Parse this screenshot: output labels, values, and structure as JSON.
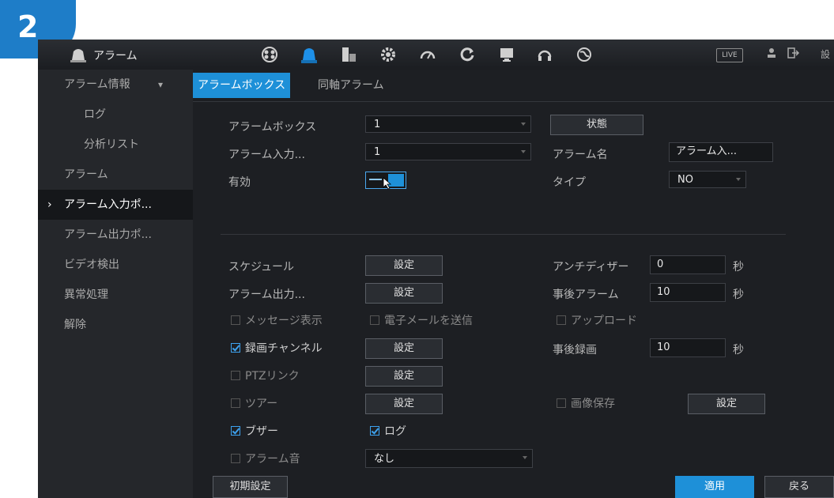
{
  "step_badge": "2",
  "app": {
    "title": "アラーム",
    "live_label": "LIVE",
    "right_text": "設"
  },
  "toolbar_icons": [
    "camera-icon",
    "alarm-icon",
    "storage-icon",
    "settings-icon",
    "gauge-icon",
    "refresh-icon",
    "display-icon",
    "headset-icon",
    "network-icon"
  ],
  "sidebar": {
    "items": [
      {
        "label": "アラーム情報",
        "arrow": "▾"
      },
      {
        "label": "ログ"
      },
      {
        "label": "分析リスト"
      },
      {
        "label": "アラーム"
      },
      {
        "label": "アラーム入力ポ...",
        "prefix": "›"
      },
      {
        "label": "アラーム出力ポ..."
      },
      {
        "label": "ビデオ検出"
      },
      {
        "label": "異常処理"
      },
      {
        "label": "解除"
      }
    ]
  },
  "tabs": [
    "アラームボックス",
    "同軸アラーム"
  ],
  "form": {
    "alarm_box": {
      "label": "アラームボックス",
      "value": "1"
    },
    "status_button": "状態",
    "alarm_input": {
      "label": "アラーム入力...",
      "value": "1"
    },
    "alarm_name": {
      "label": "アラーム名",
      "value": "アラーム入..."
    },
    "enabled_label": "有効",
    "type": {
      "label": "タイプ",
      "value": "NO"
    },
    "schedule": {
      "label": "スケジュール",
      "button": "設定"
    },
    "anti_dither": {
      "label": "アンチディザー",
      "value": "0",
      "unit": "秒"
    },
    "alarm_output": {
      "label": "アラーム出力...",
      "button": "設定"
    },
    "post_alarm": {
      "label": "事後アラーム",
      "value": "10",
      "unit": "秒"
    },
    "message_display": {
      "label": "メッセージ表示",
      "checked": false
    },
    "send_email": {
      "label": "電子メールを送信",
      "checked": false
    },
    "upload": {
      "label": "アップロード",
      "checked": false
    },
    "record_channel": {
      "label": "録画チャンネル",
      "checked": true,
      "button": "設定"
    },
    "post_record": {
      "label": "事後録画",
      "value": "10",
      "unit": "秒"
    },
    "ptz_link": {
      "label": "PTZリンク",
      "checked": false,
      "button": "設定"
    },
    "tour": {
      "label": "ツアー",
      "checked": false,
      "button": "設定"
    },
    "snapshot": {
      "label": "画像保存",
      "checked": false,
      "button": "設定"
    },
    "buzzer": {
      "label": "ブザー",
      "checked": true
    },
    "log": {
      "label": "ログ",
      "checked": true
    },
    "alarm_tone": {
      "label": "アラーム音",
      "checked": false,
      "value": "なし"
    }
  },
  "footer": {
    "default_button": "初期設定",
    "apply_button": "適用",
    "back_button": "戻る"
  },
  "colors": {
    "accent": "#1e90d8",
    "badge": "#1e7dc8",
    "background": "#1d1f23"
  }
}
